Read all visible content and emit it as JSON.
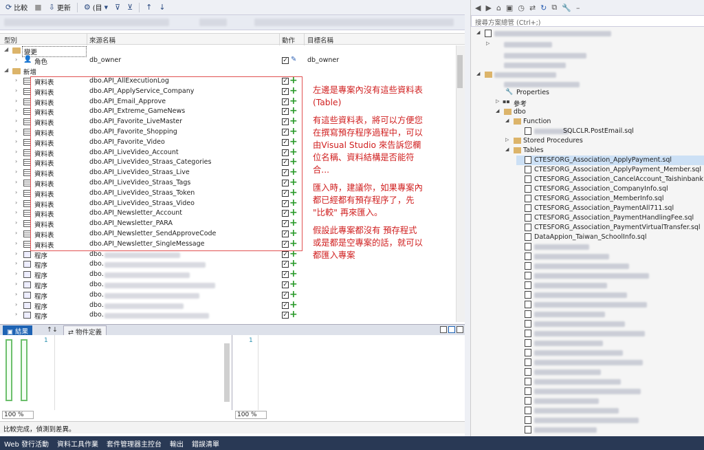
{
  "toolbar": {
    "compare_label": "比較",
    "update_label": "更新",
    "options_label": "(目"
  },
  "grid": {
    "col_type": "型別",
    "col_source": "來源名稱",
    "col_action": "動作",
    "col_target": "目標名稱"
  },
  "groups": {
    "changed": "變更",
    "added": "新增"
  },
  "changed_row": {
    "type": "角色",
    "name": "db_owner",
    "target": "db_owner"
  },
  "table_type": "資料表",
  "proc_type": "程序",
  "tables": [
    "dbo.API_AllExecutionLog",
    "dbo.API_ApplyService_Company",
    "dbo.API_Email_Approve",
    "dbo.API_Extreme_GameNews",
    "dbo.API_Favorite_LiveMaster",
    "dbo.API_Favorite_Shopping",
    "dbo.API_Favorite_Video",
    "dbo.API_LiveVideo_Account",
    "dbo.API_LiveVideo_Straas_Categories",
    "dbo.API_LiveVideo_Straas_Live",
    "dbo.API_LiveVideo_Straas_Tags",
    "dbo.API_LiveVideo_Straas_Token",
    "dbo.API_LiveVideo_Straas_Video",
    "dbo.API_Newsletter_Account",
    "dbo.API_Newsletter_PARA",
    "dbo.API_Newsletter_SendApproveCode",
    "dbo.API_Newsletter_SingleMessage"
  ],
  "procs": [
    "dbo.",
    "dbo.",
    "dbo.",
    "dbo.",
    "dbo.",
    "dbo.",
    "dbo."
  ],
  "annotation": {
    "p1": "左邊是專案內沒有這些資料表(Table)",
    "p2": "有這些資料表，將可以方便您在撰寫預存程序過程中，可以由Visual Studio 來告訴您欄位名稱、資料結構是否能符合...",
    "p3": "匯入時，建議你，如果專案內都已經都有預存程序了，先 \"比較\" 再來匯入。",
    "p4": "假設此專案都沒有 預存程式 或是都是空專案的話，就可以都匯入專案"
  },
  "panel_tabs": {
    "result": "結果",
    "definition": "物件定義"
  },
  "editor": {
    "line_left": "1",
    "line_right": "1",
    "zoom_left": "100 %",
    "zoom_right": "100 %"
  },
  "status_message": "比較完成，偵測到差異。",
  "bottom_tabs": [
    "Web 發行活動",
    "資料工具作業",
    "套件管理器主控台",
    "輸出",
    "錯誤清單"
  ],
  "solution": {
    "search_placeholder": "搜尋方案總管 (Ctrl+;)",
    "properties": "Properties",
    "references": "參考",
    "dbo": "dbo",
    "function": "Function",
    "function_file": "SQLCLR.PostEmail.sql",
    "stored_procedures": "Stored Procedures",
    "tables": "Tables",
    "table_files": [
      "CTESFORG_Association_ApplyPayment.sql",
      "CTESFORG_Association_ApplyPayment_Member.sql",
      "CTESFORG_Association_CancelAccount_Taishinbank.sql",
      "CTESFORG_Association_CompanyInfo.sql",
      "CTESFORG_Association_MemberInfo.sql",
      "CTESFORG_Association_PaymentAll711.sql",
      "CTESFORG_Association_PaymentHandlingFee.sql",
      "CTESFORG_Association_PaymentVirtualTransfer.sql",
      "DataAppion_Taiwan_SchoolInfo.sql"
    ],
    "blurred_file_count": 20
  },
  "colors": {
    "accent_blue": "#1e63b4",
    "annotation_red": "#d02020",
    "add_green": "#2a9a2a",
    "status_dark": "#293955"
  }
}
